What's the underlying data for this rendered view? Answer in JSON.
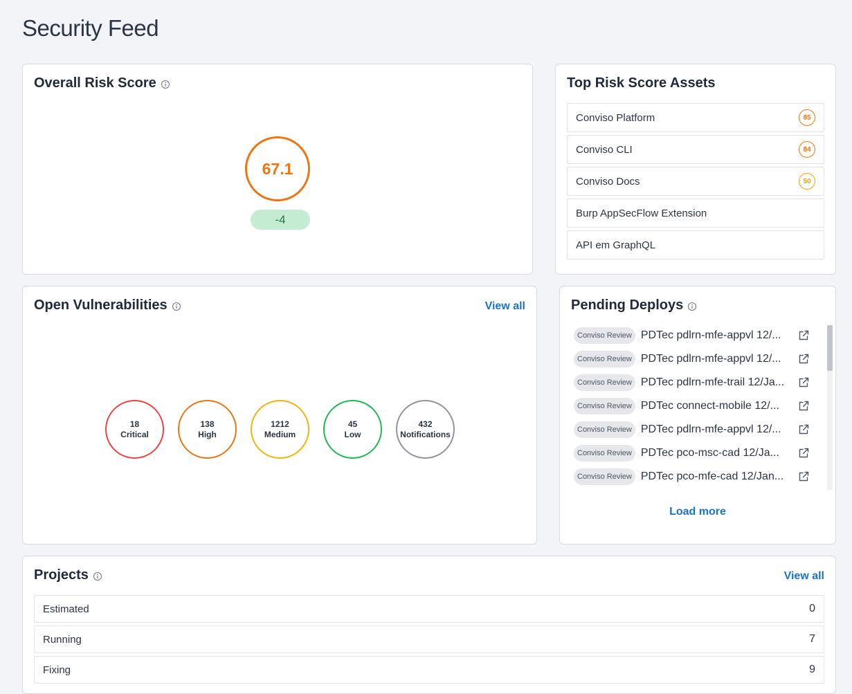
{
  "page": {
    "title": "Security Feed"
  },
  "risk": {
    "title": "Overall Risk Score",
    "score": "67.1",
    "delta": "-4",
    "score_color": "#ec7514"
  },
  "assets": {
    "title": "Top Risk Score Assets",
    "items": [
      {
        "name": "Conviso Platform",
        "score": "85",
        "color": "#ec7514"
      },
      {
        "name": "Conviso CLI",
        "score": "84",
        "color": "#ec7514"
      },
      {
        "name": "Conviso Docs",
        "score": "50",
        "color": "#f2a20c"
      },
      {
        "name": "Burp AppSecFlow Extension",
        "score": "",
        "color": ""
      },
      {
        "name": "API em GraphQL",
        "score": "",
        "color": ""
      }
    ]
  },
  "vulns": {
    "title": "Open Vulnerabilities",
    "view_all": "View all",
    "severities": [
      {
        "count": "18",
        "label": "Critical",
        "color": "#ee4444"
      },
      {
        "count": "138",
        "label": "High",
        "color": "#ec7514"
      },
      {
        "count": "1212",
        "label": "Medium",
        "color": "#f5b30c"
      },
      {
        "count": "45",
        "label": "Low",
        "color": "#1fb855"
      },
      {
        "count": "432",
        "label": "Notifications",
        "color": "#8f949d"
      }
    ]
  },
  "deploys": {
    "title": "Pending Deploys",
    "load_more": "Load more",
    "items": [
      {
        "tag": "Conviso Review",
        "name": "PDTec pdlrn-mfe-appvl 12/..."
      },
      {
        "tag": "Conviso Review",
        "name": "PDTec pdlrn-mfe-appvl 12/..."
      },
      {
        "tag": "Conviso Review",
        "name": "PDTec pdlrn-mfe-trail 12/Ja..."
      },
      {
        "tag": "Conviso Review",
        "name": "PDTec connect-mobile 12/..."
      },
      {
        "tag": "Conviso Review",
        "name": "PDTec pdlrn-mfe-appvl 12/..."
      },
      {
        "tag": "Conviso Review",
        "name": "PDTec pco-msc-cad 12/Ja..."
      },
      {
        "tag": "Conviso Review",
        "name": "PDTec pco-mfe-cad 12/Jan..."
      }
    ]
  },
  "projects": {
    "title": "Projects",
    "view_all": "View all",
    "items": [
      {
        "label": "Estimated",
        "count": "0"
      },
      {
        "label": "Running",
        "count": "7"
      },
      {
        "label": "Fixing",
        "count": "9"
      }
    ]
  },
  "icons": {
    "info": "info-icon",
    "external_link": "external-link-icon"
  }
}
